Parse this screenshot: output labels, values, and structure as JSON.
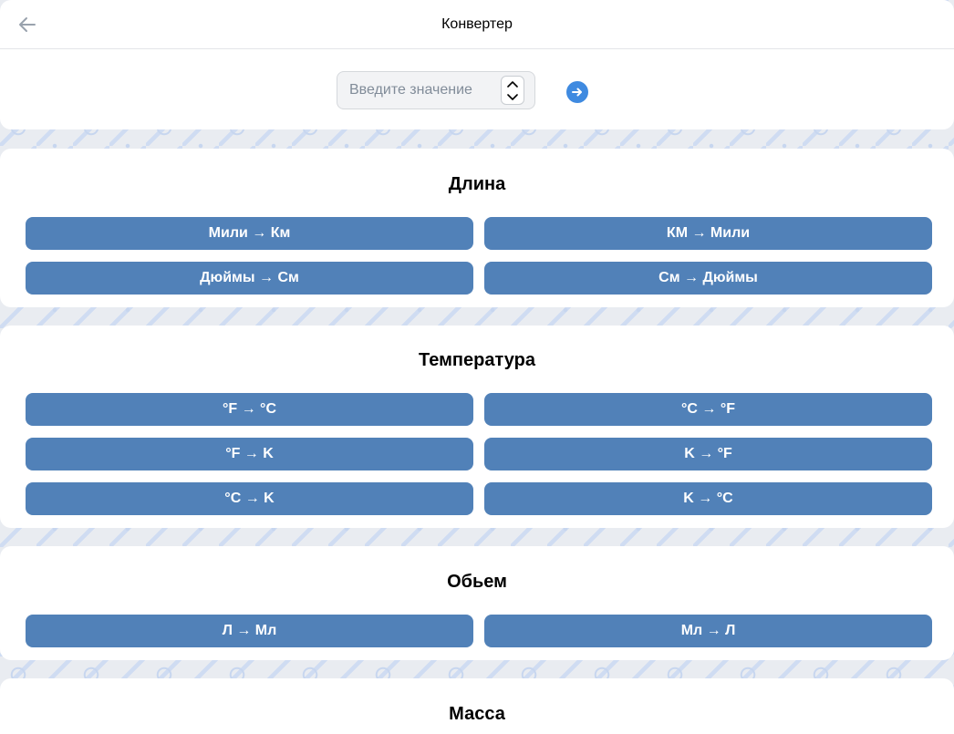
{
  "header": {
    "title": "Конвертер",
    "back_icon": "arrow-left-icon"
  },
  "input": {
    "placeholder": "Введите значение",
    "value": "",
    "submit_icon": "arrow-right-circle-icon"
  },
  "sections": [
    {
      "title": "Длина",
      "buttons": [
        "Мили → Км",
        "КМ → Мили",
        "Дюймы → См",
        "См → Дюймы"
      ]
    },
    {
      "title": "Температура",
      "buttons": [
        "°F → °C",
        "°C → °F",
        "°F → K",
        "K → °F",
        "°C → K",
        "K → °C"
      ]
    },
    {
      "title": "Обьем",
      "buttons": [
        "Л → Мл",
        "Мл → Л"
      ]
    },
    {
      "title": "Масса",
      "buttons": []
    }
  ],
  "colors": {
    "button": "#5181b8",
    "accent": "#3f8ae0",
    "background": "#e9ecf1"
  }
}
